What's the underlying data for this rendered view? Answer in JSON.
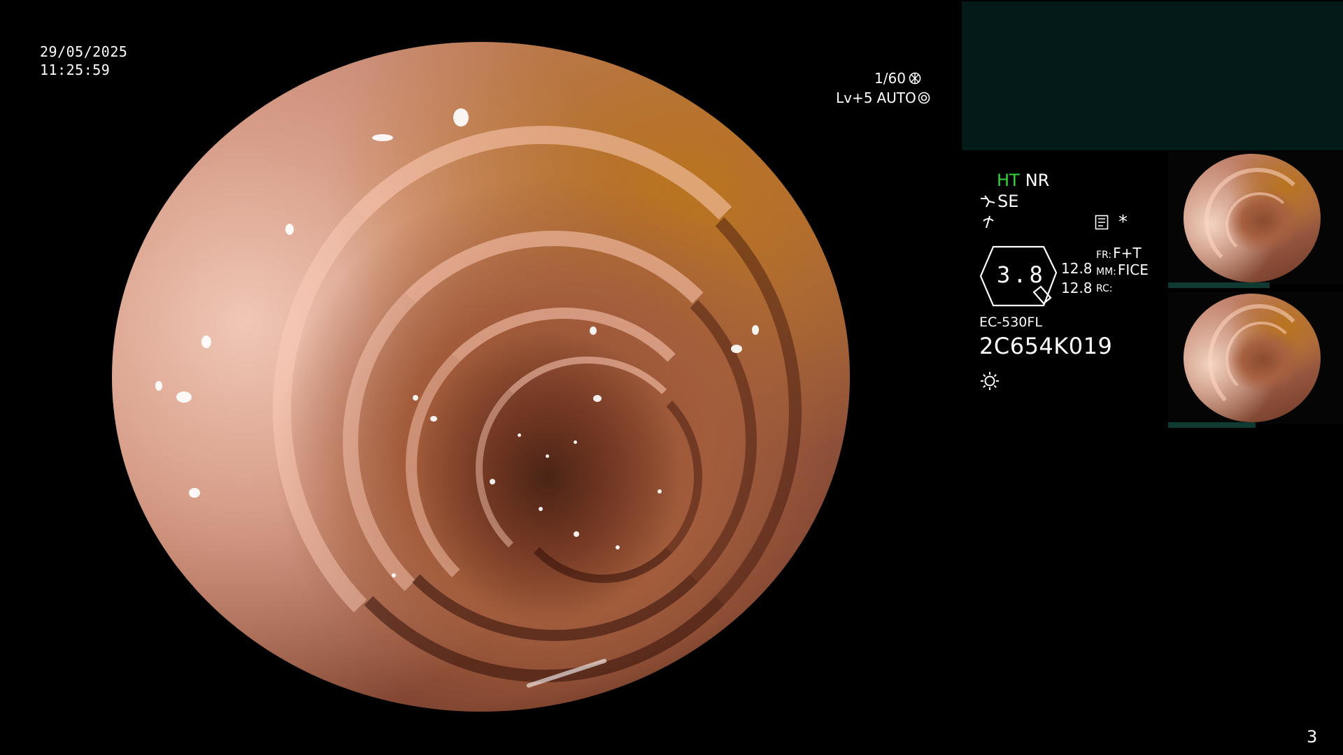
{
  "overlay": {
    "date": "29/05/2025",
    "time": "11:25:59",
    "shutter": "1/60",
    "level": "Lv+5",
    "exposure_mode": "AUTO"
  },
  "settings": {
    "ht": "HT",
    "nr": "NR",
    "se": "SE",
    "gauge_value": "3.8",
    "val_top": "12.8",
    "val_bottom": "12.8",
    "fr_label": "FR:",
    "fr_value": "F+T",
    "mm_label": "MM:",
    "mm_value": "FICE",
    "rc_label": "RC:",
    "asterisk": "*",
    "scope_model": "EC-530FL",
    "serial": "2C654K019"
  },
  "page_number": "3",
  "colors": {
    "ht_green": "#36d43a",
    "top_panel": "#031a18",
    "thumb_bar": "#0f3a32"
  },
  "icons": [
    "shutter-icon",
    "auto-exposure-icon",
    "enhance-icon",
    "freeze-icon",
    "memory-card-icon",
    "light-icon"
  ]
}
